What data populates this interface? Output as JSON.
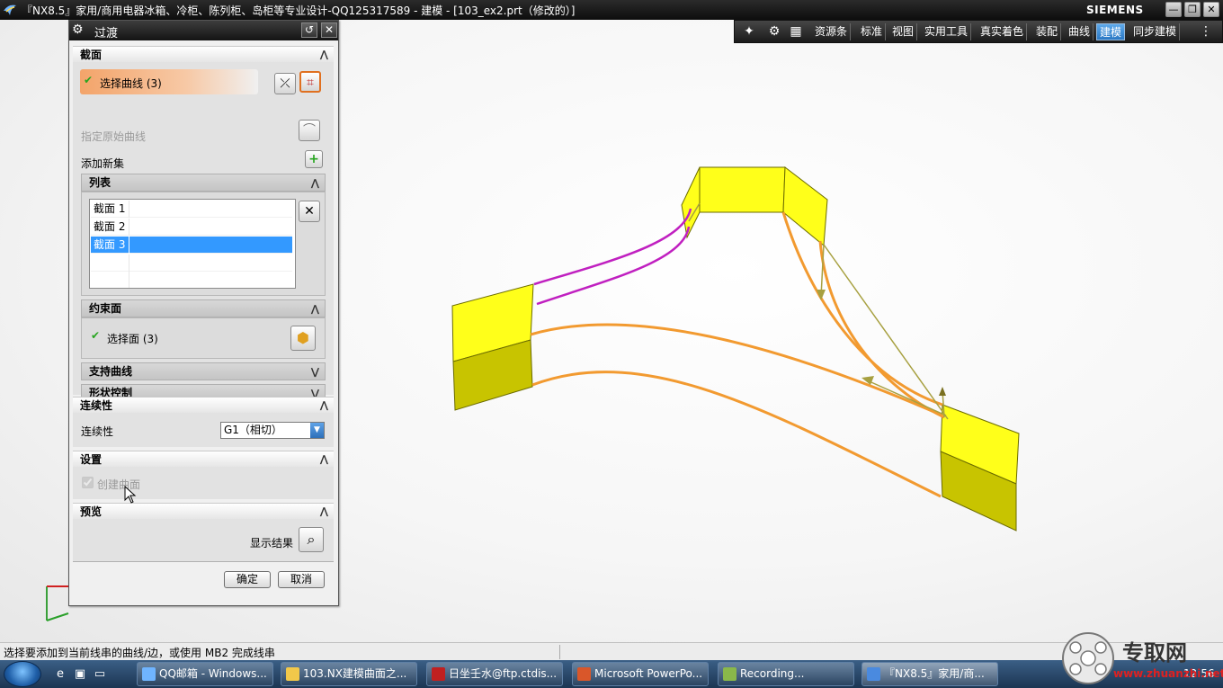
{
  "window": {
    "title": "『NX8.5』家用/商用电器冰箱、冷柜、陈列柜、岛柜等专业设计-QQ125317589 - 建模 - [103_ex2.prt（修改的）]",
    "brand": "SIEMENS",
    "buttons": [
      "—",
      "❐",
      "✕"
    ]
  },
  "toolbar": {
    "items": [
      "资源条",
      "标准",
      "视图",
      "实用工具",
      "真实着色",
      "装配",
      "曲线",
      "建模",
      "同步建模"
    ],
    "active": "建模"
  },
  "dialog": {
    "title": "过渡",
    "sections": {
      "section": {
        "label": "截面",
        "select_curve": "选择曲线 (3)",
        "specify_original": "指定原始曲线",
        "add_new_set": "添加新集",
        "list": {
          "label": "列表",
          "items": [
            "截面 1",
            "截面 2",
            "截面 3"
          ],
          "selected_index": 2
        }
      },
      "constraint": {
        "label": "约束面",
        "select_face": "选择面 (3)"
      },
      "support": {
        "label": "支持曲线"
      },
      "shape": {
        "label": "形状控制"
      },
      "continuity": {
        "label": "连续性",
        "field_label": "连续性",
        "value": "G1（相切）"
      },
      "settings": {
        "label": "设置",
        "create_surface": "创建曲面",
        "create_surface_checked": true
      },
      "preview": {
        "label": "预览",
        "show_result": "显示结果"
      }
    },
    "ok": "确定",
    "cancel": "取消"
  },
  "status": {
    "text": "选择要添加到当前线串的曲线/边，或使用 MB2 完成线串"
  },
  "taskbar": {
    "tasks": [
      "QQ邮箱 - Windows...",
      "103.NX建模曲面之...",
      "日坐壬水@ftp.ctdis...",
      "Microsoft PowerPo...",
      "Recording...",
      "『NX8.5』家用/商..."
    ],
    "clock": "12:56"
  },
  "watermark": {
    "text": "专取网",
    "sub": "www.zhuanzhi.net"
  }
}
